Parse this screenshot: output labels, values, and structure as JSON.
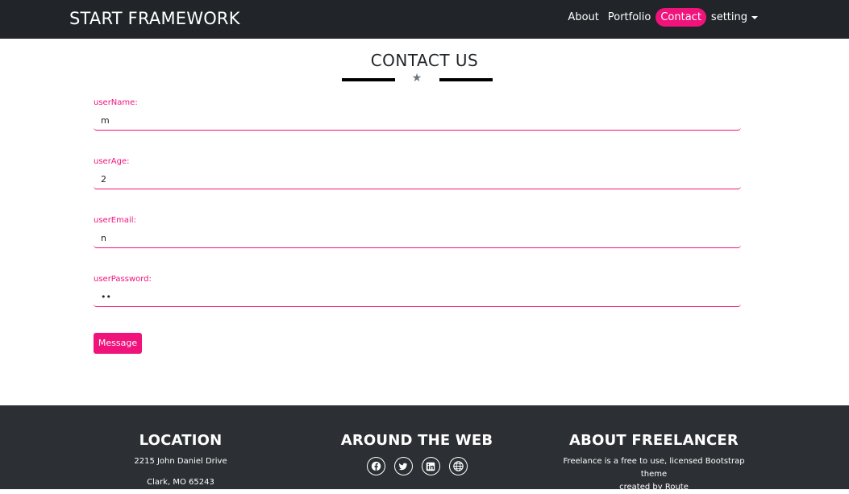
{
  "nav": {
    "brand": "START FRAMEWORK",
    "links": [
      "About",
      "Portfolio",
      "Contact",
      "setting"
    ]
  },
  "contact": {
    "title": "CONTACT US",
    "fields": [
      {
        "label": "userName:",
        "value": "m"
      },
      {
        "label": "userAge:",
        "value": "2"
      },
      {
        "label": "userEmail:",
        "value": "n"
      },
      {
        "label": "userPassword:",
        "value": "••"
      }
    ],
    "button": "Message"
  },
  "footer": {
    "location": {
      "title": "LOCATION",
      "line1": "2215 John Daniel Drive",
      "line2": "Clark, MO 65243"
    },
    "web": {
      "title": "AROUND THE WEB",
      "icons": [
        "facebook-icon",
        "twitter-icon",
        "linkedin-icon",
        "globe-icon"
      ]
    },
    "about": {
      "title": "ABOUT FREELANCER",
      "line1": "Freelance is a free to use, licensed Bootstrap theme",
      "line2": "created by Route"
    }
  },
  "colors": {
    "accent": "#f0137b",
    "dark": "#212529",
    "footer": "#2c3034"
  }
}
